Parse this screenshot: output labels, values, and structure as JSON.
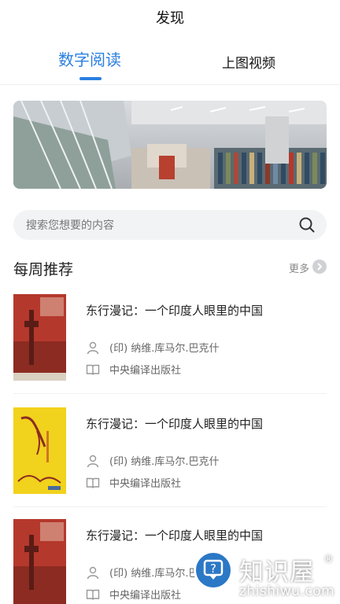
{
  "header": {
    "title": "发现"
  },
  "tabs": [
    {
      "label": "数字阅读",
      "active": true
    },
    {
      "label": "上图视频",
      "active": false
    }
  ],
  "search": {
    "placeholder": "搜索您想要的内容"
  },
  "weekly": {
    "label": "每周推荐",
    "more_label": "更多"
  },
  "books": [
    {
      "title": "东行漫记：一个印度人眼里的中国",
      "author": "(印) 纳维.库马尔.巴克什",
      "publisher": "中央编译出版社",
      "cover_color": "#b5382c"
    },
    {
      "title": "东行漫记：一个印度人眼里的中国",
      "author": "(印) 纳维.库马尔.巴克什",
      "publisher": "中央编译出版社",
      "cover_color": "#f1d21c"
    },
    {
      "title": "东行漫记：一个印度人眼里的中国",
      "author": "(印) 纳维.库马尔.巴克什",
      "publisher": "中央编译出版社",
      "cover_color": "#b5382c"
    }
  ],
  "watermark": {
    "brand": "知识屋",
    "url": "zhishiwu.com"
  },
  "colors": {
    "accent": "#2a7fe0"
  }
}
